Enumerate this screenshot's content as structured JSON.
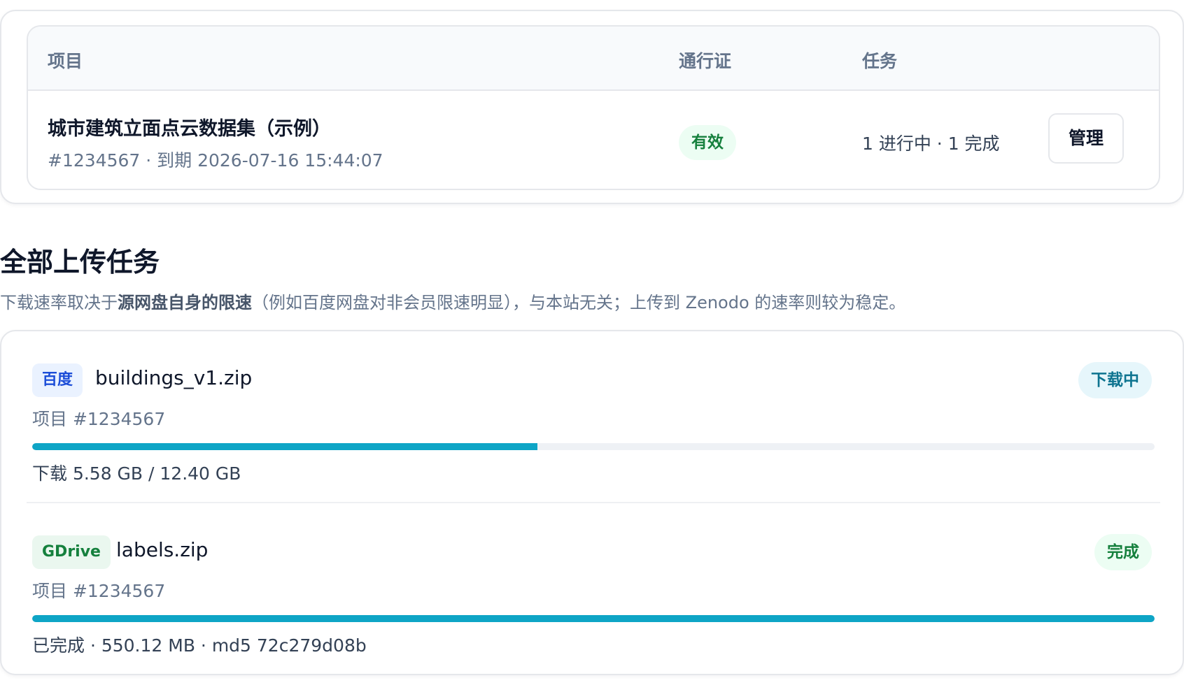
{
  "table": {
    "headers": {
      "project": "项目",
      "pass": "通行证",
      "tasks": "任务"
    },
    "rows": [
      {
        "title": "城市建筑立面点云数据集（示例）",
        "meta": "#1234567 · 到期 2026-07-16 15:44:07",
        "pass_status": "有效",
        "tasks_summary": "1 进行中 · 1 完成",
        "action_label": "管理"
      }
    ]
  },
  "uploads": {
    "title": "全部上传任务",
    "note_prefix": "下载速率取决于",
    "note_bold": "源网盘自身的限速",
    "note_suffix": "（例如百度网盘对非会员限速明显），与本站无关；上传到 Zenodo 的速率则较为稳定。",
    "tasks": [
      {
        "source": "百度",
        "file_name": "buildings_v1.zip",
        "status": "下载中",
        "project": "项目 #1234567",
        "progress_fraction": 0.45,
        "progress_text": "下载 5.58 GB / 12.40 GB"
      },
      {
        "source": "GDrive",
        "file_name": "labels.zip",
        "status": "完成",
        "project": "项目 #1234567",
        "progress_fraction": 1.0,
        "progress_text": "已完成 · 550.12 MB · md5 72c279d08b"
      }
    ]
  },
  "colors": {
    "accent": "#0ea5c6",
    "success": "#15803d",
    "baidu": "#1d4ed8",
    "muted": "#64748b"
  }
}
